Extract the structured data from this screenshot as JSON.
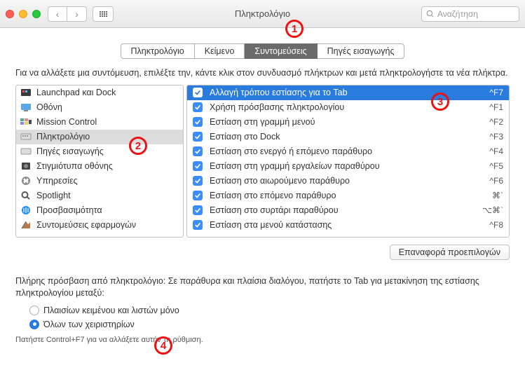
{
  "window_title": "Πληκτρολόγιο",
  "search_placeholder": "Αναζήτηση",
  "tabs": [
    "Πληκτρολόγιο",
    "Κείμενο",
    "Συντομεύσεις",
    "Πηγές εισαγωγής"
  ],
  "active_tab_index": 2,
  "instruction": "Για να αλλάξετε μια συντόμευση, επιλέξτε την, κάντε κλικ στον συνδυασμό πλήκτρων και μετά πληκτρολογήστε τα νέα πλήκτρα.",
  "sidebar_items": [
    "Launchpad και Dock",
    "Οθόνη",
    "Mission Control",
    "Πληκτρολόγιο",
    "Πηγές εισαγωγής",
    "Στιγμιότυπα οθόνης",
    "Υπηρεσίες",
    "Spotlight",
    "Προσβασιμότητα",
    "Συντομεύσεις εφαρμογών"
  ],
  "selected_sidebar_index": 3,
  "shortcuts": [
    {
      "label": "Αλλαγή τρόπου εστίασης για το Tab",
      "key": "^F7"
    },
    {
      "label": "Χρήση πρόσβασης πληκτρολογίου",
      "key": "^F1"
    },
    {
      "label": "Εστίαση στη γραμμή μενού",
      "key": "^F2"
    },
    {
      "label": "Εστίαση στο Dock",
      "key": "^F3"
    },
    {
      "label": "Εστίαση στο ενεργό ή επόμενο παράθυρο",
      "key": "^F4"
    },
    {
      "label": "Εστίαση στη γραμμή εργαλείων παραθύρου",
      "key": "^F5"
    },
    {
      "label": "Εστίαση στο αιωρούμενο παράθυρο",
      "key": "^F6"
    },
    {
      "label": "Εστίαση στο επόμενο παράθυρο",
      "key": "⌘`"
    },
    {
      "label": "Εστίαση στο συρτάρι παραθύρου",
      "key": "⌥⌘`"
    },
    {
      "label": "Εστίαση στα μενού κατάστασης",
      "key": "^F8"
    }
  ],
  "selected_shortcut_index": 0,
  "restore_button": "Επαναφορά προεπιλογών",
  "footer_text": "Πλήρης πρόσβαση από πληκτρολόγιο: Σε παράθυρα και πλαίσια διαλόγου, πατήστε το Tab για μετακίνηση της εστίασης πληκτρολογίου μεταξύ:",
  "radio_options": [
    "Πλαισίων κειμένου και λιστών μόνο",
    "Όλων των χειριστηρίων"
  ],
  "selected_radio_index": 1,
  "hint": "Πατήστε Control+F7 για να αλλάξετε αυτήν τη ρύθμιση.",
  "annotations": [
    "1",
    "2",
    "3",
    "4"
  ]
}
